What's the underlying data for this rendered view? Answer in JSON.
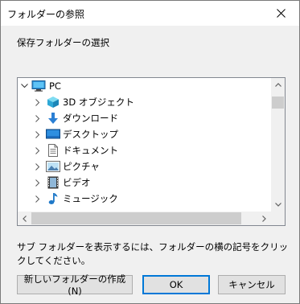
{
  "window": {
    "title": "フォルダーの参照"
  },
  "instruction": "保存フォルダーの選択",
  "tree": {
    "items": [
      {
        "label": "PC",
        "icon": "pc-icon",
        "expanded": true
      },
      {
        "label": "3D オブジェクト",
        "icon": "3d-objects-icon"
      },
      {
        "label": "ダウンロード",
        "icon": "downloads-icon"
      },
      {
        "label": "デスクトップ",
        "icon": "desktop-icon"
      },
      {
        "label": "ドキュメント",
        "icon": "documents-icon"
      },
      {
        "label": "ピクチャ",
        "icon": "pictures-icon"
      },
      {
        "label": "ビデオ",
        "icon": "videos-icon"
      },
      {
        "label": "ミュージック",
        "icon": "music-icon"
      }
    ]
  },
  "help_text": "サブ フォルダーを表示するには、フォルダーの横の記号をクリックしてください。",
  "buttons": {
    "new_folder": "新しいフォルダーの作成(N)",
    "ok": "OK",
    "cancel": "キャンセル"
  },
  "colors": {
    "accent": "#0078d7",
    "border": "#828790",
    "dialog_bg": "#f0f0f0"
  }
}
